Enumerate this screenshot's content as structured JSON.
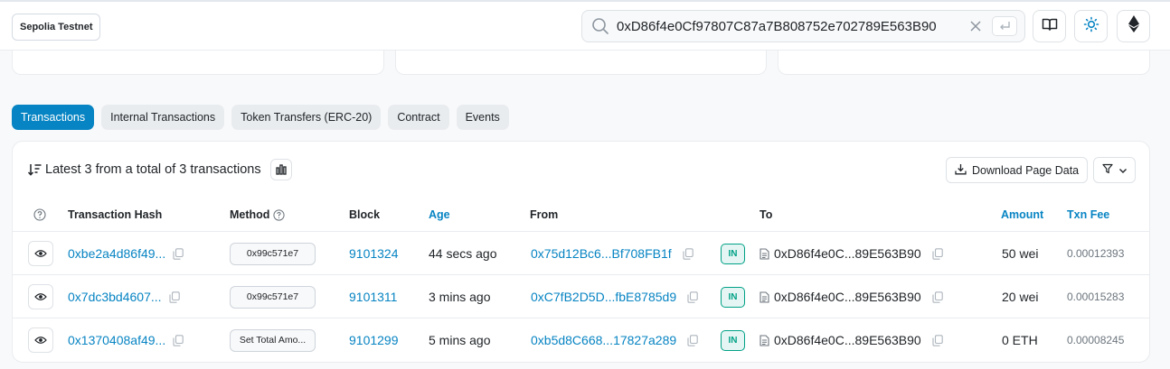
{
  "header": {
    "network_label": "Sepolia Testnet",
    "search_value": "0xD86f4e0Cf97807C87a7B808752e702789E563B90",
    "icons": {
      "search": "search-icon",
      "clear": "close-icon",
      "enter": "enter-icon",
      "docs": "book-icon",
      "theme": "sun-icon",
      "network": "ethereum-icon"
    }
  },
  "tabs": [
    {
      "label": "Transactions",
      "active": true
    },
    {
      "label": "Internal Transactions",
      "active": false
    },
    {
      "label": "Token Transfers (ERC-20)",
      "active": false
    },
    {
      "label": "Contract",
      "active": false
    },
    {
      "label": "Events",
      "active": false
    }
  ],
  "summary": {
    "text": "Latest 3 from a total of 3 transactions",
    "download_label": "Download Page Data"
  },
  "columns": {
    "hash": "Transaction Hash",
    "method": "Method",
    "block": "Block",
    "age": "Age",
    "from": "From",
    "to": "To",
    "amount": "Amount",
    "fee": "Txn Fee"
  },
  "rows": [
    {
      "hash": "0xbe2a4d86f49...",
      "method": "0x99c571e7",
      "block": "9101324",
      "age": "44 secs ago",
      "from": "0x75d12Bc6...Bf708FB1f",
      "direction": "IN",
      "to": "0xD86f4e0C...89E563B90",
      "amount": "50 wei",
      "fee": "0.00012393"
    },
    {
      "hash": "0x7dc3bd4607...",
      "method": "0x99c571e7",
      "block": "9101311",
      "age": "3 mins ago",
      "from": "0xC7fB2D5D...fbE8785d9",
      "direction": "IN",
      "to": "0xD86f4e0C...89E563B90",
      "amount": "20 wei",
      "fee": "0.00015283"
    },
    {
      "hash": "0x1370408af49...",
      "method": "Set Total Amo...",
      "block": "9101299",
      "age": "5 mins ago",
      "from": "0xb5d8C668...17827a289",
      "direction": "IN",
      "to": "0xD86f4e0C...89E563B90",
      "amount": "0 ETH",
      "fee": "0.00008245"
    }
  ],
  "colors": {
    "accent": "#0784c3",
    "in_badge": "#00a186",
    "text": "#212529",
    "muted": "#6c757d"
  }
}
